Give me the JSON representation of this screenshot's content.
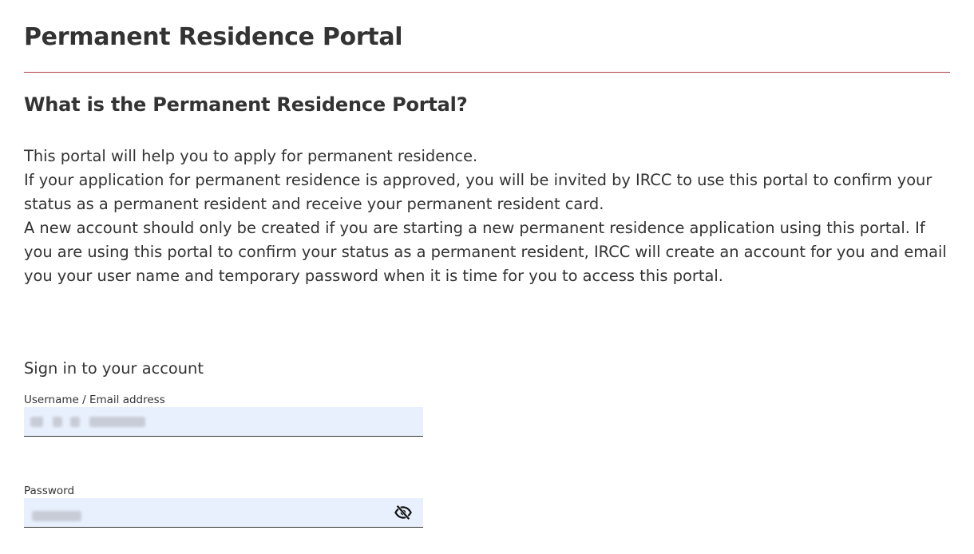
{
  "header": {
    "title": "Permanent Residence Portal"
  },
  "intro": {
    "heading": "What is the Permanent Residence Portal?",
    "paragraphs": [
      "This portal will help you to apply for permanent residence.",
      "If your application for permanent residence is approved, you will be invited by IRCC to use this portal to confirm your status as a permanent resident and receive your permanent resident card.",
      "A new account should only be created if you are starting a new permanent residence application using this portal. If you are using this portal to confirm your status as a permanent resident, IRCC will create an account for you and email you your user name and temporary password when it is time for you to access this portal."
    ]
  },
  "signin": {
    "heading": "Sign in to your account",
    "username": {
      "label": "Username / Email address",
      "value": ""
    },
    "password": {
      "label": "Password",
      "value": "",
      "toggle_icon": "eye-slash-icon"
    }
  },
  "colors": {
    "rule": "#af3c43",
    "autofill_background": "#e8f0fe",
    "text": "#333333"
  }
}
